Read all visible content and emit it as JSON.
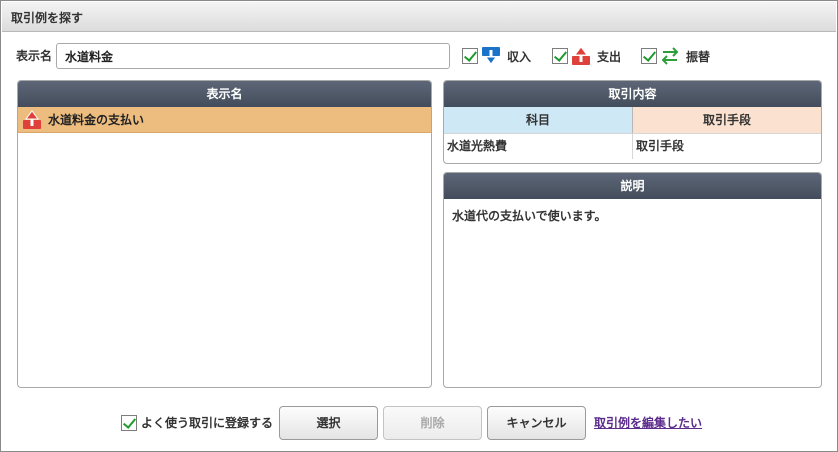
{
  "window": {
    "title": "取引例を探す"
  },
  "search": {
    "label": "表示名",
    "value": "水道料金"
  },
  "filters": [
    {
      "label": "収入",
      "checked": true,
      "icon": "income-down-arrow-icon",
      "color": "#1a73c8"
    },
    {
      "label": "支出",
      "checked": true,
      "icon": "expense-up-arrow-icon",
      "color": "#e0403a"
    },
    {
      "label": "振替",
      "checked": true,
      "icon": "transfer-arrows-icon",
      "color": "#2e9e3a"
    }
  ],
  "list": {
    "header": "表示名",
    "items": [
      {
        "label": "水道料金の支払い",
        "type": "支出",
        "selected": true
      }
    ]
  },
  "detail": {
    "header": "取引内容",
    "columns": [
      "科目",
      "取引手段"
    ],
    "row": [
      "水道光熱費",
      "取引手段"
    ]
  },
  "description": {
    "header": "説明",
    "text": "水道代の支払いで使います。"
  },
  "footer": {
    "favorite_label": "よく使う取引に登録する",
    "favorite_checked": true,
    "select_label": "選択",
    "delete_label": "削除",
    "cancel_label": "キャンセル",
    "edit_link": "取引例を編集したい"
  },
  "colors": {
    "header_bg": "#4b5464",
    "selected_row": "#edbc7f",
    "account_col": "#cfe8f6",
    "method_col": "#fbe1cf"
  }
}
